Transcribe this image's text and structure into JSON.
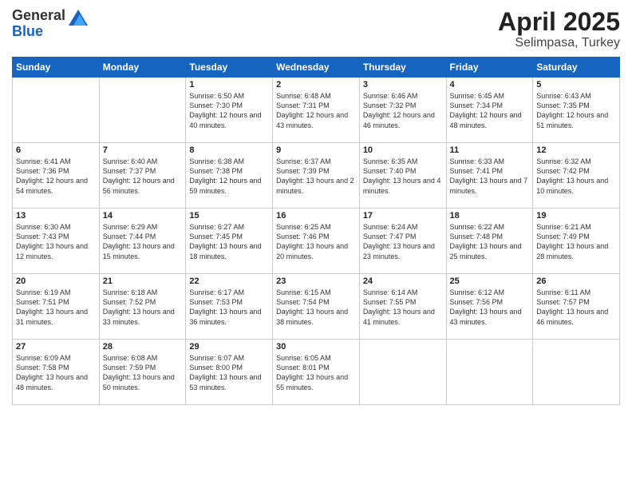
{
  "logo": {
    "general": "General",
    "blue": "Blue"
  },
  "title": {
    "month": "April 2025",
    "location": "Selimpasa, Turkey"
  },
  "weekdays": [
    "Sunday",
    "Monday",
    "Tuesday",
    "Wednesday",
    "Thursday",
    "Friday",
    "Saturday"
  ],
  "weeks": [
    [
      {
        "day": null,
        "info": null
      },
      {
        "day": null,
        "info": null
      },
      {
        "day": "1",
        "info": "Sunrise: 6:50 AM\nSunset: 7:30 PM\nDaylight: 12 hours and 40 minutes."
      },
      {
        "day": "2",
        "info": "Sunrise: 6:48 AM\nSunset: 7:31 PM\nDaylight: 12 hours and 43 minutes."
      },
      {
        "day": "3",
        "info": "Sunrise: 6:46 AM\nSunset: 7:32 PM\nDaylight: 12 hours and 46 minutes."
      },
      {
        "day": "4",
        "info": "Sunrise: 6:45 AM\nSunset: 7:34 PM\nDaylight: 12 hours and 48 minutes."
      },
      {
        "day": "5",
        "info": "Sunrise: 6:43 AM\nSunset: 7:35 PM\nDaylight: 12 hours and 51 minutes."
      }
    ],
    [
      {
        "day": "6",
        "info": "Sunrise: 6:41 AM\nSunset: 7:36 PM\nDaylight: 12 hours and 54 minutes."
      },
      {
        "day": "7",
        "info": "Sunrise: 6:40 AM\nSunset: 7:37 PM\nDaylight: 12 hours and 56 minutes."
      },
      {
        "day": "8",
        "info": "Sunrise: 6:38 AM\nSunset: 7:38 PM\nDaylight: 12 hours and 59 minutes."
      },
      {
        "day": "9",
        "info": "Sunrise: 6:37 AM\nSunset: 7:39 PM\nDaylight: 13 hours and 2 minutes."
      },
      {
        "day": "10",
        "info": "Sunrise: 6:35 AM\nSunset: 7:40 PM\nDaylight: 13 hours and 4 minutes."
      },
      {
        "day": "11",
        "info": "Sunrise: 6:33 AM\nSunset: 7:41 PM\nDaylight: 13 hours and 7 minutes."
      },
      {
        "day": "12",
        "info": "Sunrise: 6:32 AM\nSunset: 7:42 PM\nDaylight: 13 hours and 10 minutes."
      }
    ],
    [
      {
        "day": "13",
        "info": "Sunrise: 6:30 AM\nSunset: 7:43 PM\nDaylight: 13 hours and 12 minutes."
      },
      {
        "day": "14",
        "info": "Sunrise: 6:29 AM\nSunset: 7:44 PM\nDaylight: 13 hours and 15 minutes."
      },
      {
        "day": "15",
        "info": "Sunrise: 6:27 AM\nSunset: 7:45 PM\nDaylight: 13 hours and 18 minutes."
      },
      {
        "day": "16",
        "info": "Sunrise: 6:25 AM\nSunset: 7:46 PM\nDaylight: 13 hours and 20 minutes."
      },
      {
        "day": "17",
        "info": "Sunrise: 6:24 AM\nSunset: 7:47 PM\nDaylight: 13 hours and 23 minutes."
      },
      {
        "day": "18",
        "info": "Sunrise: 6:22 AM\nSunset: 7:48 PM\nDaylight: 13 hours and 25 minutes."
      },
      {
        "day": "19",
        "info": "Sunrise: 6:21 AM\nSunset: 7:49 PM\nDaylight: 13 hours and 28 minutes."
      }
    ],
    [
      {
        "day": "20",
        "info": "Sunrise: 6:19 AM\nSunset: 7:51 PM\nDaylight: 13 hours and 31 minutes."
      },
      {
        "day": "21",
        "info": "Sunrise: 6:18 AM\nSunset: 7:52 PM\nDaylight: 13 hours and 33 minutes."
      },
      {
        "day": "22",
        "info": "Sunrise: 6:17 AM\nSunset: 7:53 PM\nDaylight: 13 hours and 36 minutes."
      },
      {
        "day": "23",
        "info": "Sunrise: 6:15 AM\nSunset: 7:54 PM\nDaylight: 13 hours and 38 minutes."
      },
      {
        "day": "24",
        "info": "Sunrise: 6:14 AM\nSunset: 7:55 PM\nDaylight: 13 hours and 41 minutes."
      },
      {
        "day": "25",
        "info": "Sunrise: 6:12 AM\nSunset: 7:56 PM\nDaylight: 13 hours and 43 minutes."
      },
      {
        "day": "26",
        "info": "Sunrise: 6:11 AM\nSunset: 7:57 PM\nDaylight: 13 hours and 46 minutes."
      }
    ],
    [
      {
        "day": "27",
        "info": "Sunrise: 6:09 AM\nSunset: 7:58 PM\nDaylight: 13 hours and 48 minutes."
      },
      {
        "day": "28",
        "info": "Sunrise: 6:08 AM\nSunset: 7:59 PM\nDaylight: 13 hours and 50 minutes."
      },
      {
        "day": "29",
        "info": "Sunrise: 6:07 AM\nSunset: 8:00 PM\nDaylight: 13 hours and 53 minutes."
      },
      {
        "day": "30",
        "info": "Sunrise: 6:05 AM\nSunset: 8:01 PM\nDaylight: 13 hours and 55 minutes."
      },
      {
        "day": null,
        "info": null
      },
      {
        "day": null,
        "info": null
      },
      {
        "day": null,
        "info": null
      }
    ]
  ]
}
